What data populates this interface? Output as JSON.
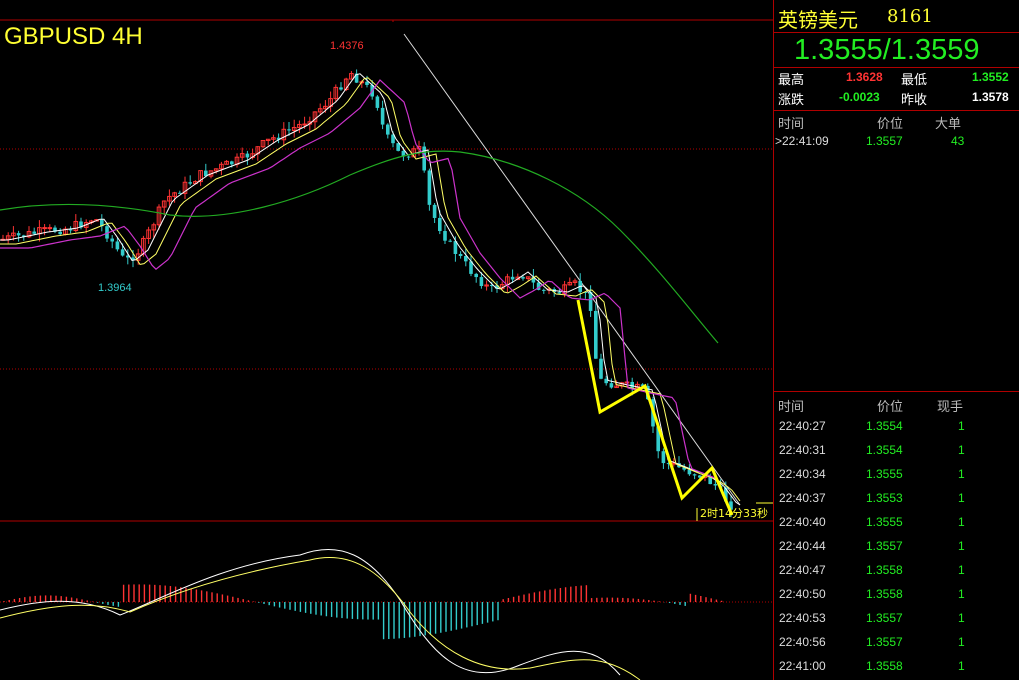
{
  "chart": {
    "title": "GBPUSD 4H",
    "high_label": "1.4376",
    "low_label": "1.3964",
    "countdown": "2时14分33秒",
    "colors": {
      "bull": "#ff3333",
      "bear": "#33cccc",
      "ma_fast": "#ffffff",
      "ma_mid": "#ffff66",
      "ma_slow": "#cc33cc",
      "ma_long": "#22aa22",
      "arrow": "#ffff00",
      "grid": "#b00000"
    }
  },
  "panel": {
    "name": "英镑美元",
    "code": "8161",
    "quote": "1.3555/1.3559",
    "stats": {
      "high_label": "最高",
      "high_value": "1.3628",
      "low_label": "最低",
      "low_value": "1.3552",
      "change_label": "涨跌",
      "change_value": "-0.0023",
      "prev_label": "昨收",
      "prev_value": "1.3578"
    },
    "big_orders": {
      "headers": [
        "时间",
        "价位",
        "大单"
      ],
      "rows": [
        {
          "time": ">22:41:09",
          "price": "1.3557",
          "vol": "43"
        }
      ]
    },
    "ticks": {
      "headers": [
        "时间",
        "价位",
        "现手"
      ],
      "rows": [
        {
          "time": "22:40:27",
          "price": "1.3554",
          "vol": "1"
        },
        {
          "time": "22:40:31",
          "price": "1.3554",
          "vol": "1"
        },
        {
          "time": "22:40:34",
          "price": "1.3555",
          "vol": "1"
        },
        {
          "time": "22:40:37",
          "price": "1.3553",
          "vol": "1"
        },
        {
          "time": "22:40:40",
          "price": "1.3555",
          "vol": "1"
        },
        {
          "time": "22:40:44",
          "price": "1.3557",
          "vol": "1"
        },
        {
          "time": "22:40:47",
          "price": "1.3558",
          "vol": "1"
        },
        {
          "time": "22:40:50",
          "price": "1.3558",
          "vol": "1"
        },
        {
          "time": "22:40:53",
          "price": "1.3557",
          "vol": "1"
        },
        {
          "time": "22:40:56",
          "price": "1.3557",
          "vol": "1"
        },
        {
          "time": "22:41:00",
          "price": "1.3558",
          "vol": "1"
        }
      ]
    }
  }
}
